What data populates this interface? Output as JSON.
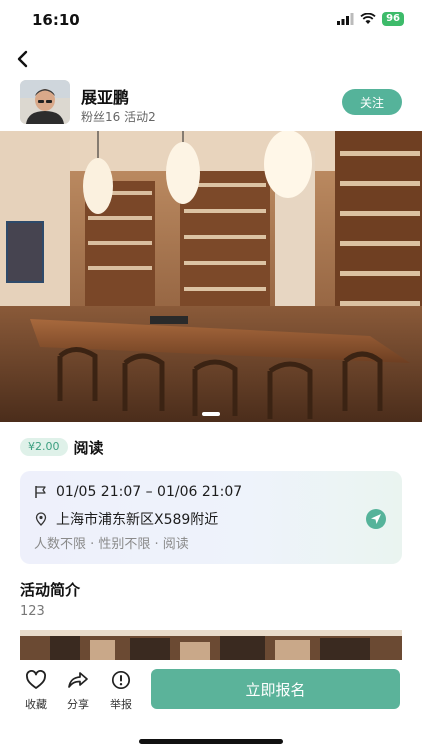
{
  "status_bar": {
    "time": "16:10",
    "battery": "96"
  },
  "author": {
    "name": "展亚鹏",
    "meta": "粉丝16  活动2",
    "follow_label": "关注"
  },
  "activity": {
    "price": "¥2.00",
    "title": "阅读",
    "datetime": "01/05 21:07 – 01/06 21:07",
    "location": "上海市浦东新区X589附近",
    "tags": "人数不限 · 性别不限 · 阅读"
  },
  "intro": {
    "heading": "活动简介",
    "text": "123"
  },
  "bottom_bar": {
    "favorite_label": "收藏",
    "share_label": "分享",
    "report_label": "举报",
    "signup_label": "立即报名"
  },
  "colors": {
    "accent": "#55b39a",
    "price_bg": "#dff1e9"
  },
  "icons": [
    "back-arrow-icon",
    "flag-icon",
    "location-pin-icon",
    "navigation-icon",
    "heart-icon",
    "share-icon",
    "report-icon",
    "signal-icon",
    "wifi-icon",
    "battery-icon"
  ]
}
